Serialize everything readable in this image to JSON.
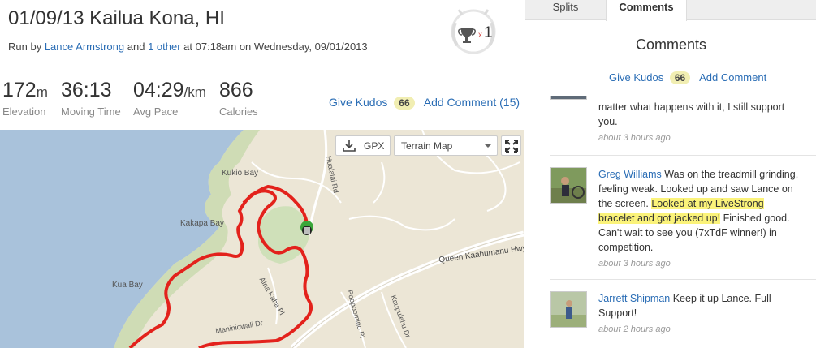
{
  "activity": {
    "title": "01/09/13 Kailua Kona, HI",
    "subtitle_prefix": "Run by",
    "athlete": "Lance Armstrong",
    "and": "and",
    "others": "1 other",
    "subtitle_suffix": "at 07:18am on Wednesday, 09/01/2013",
    "trophy_multiplier": "x",
    "trophy_count": "1"
  },
  "stats": [
    {
      "value": "172",
      "unit": "m",
      "label": "Elevation"
    },
    {
      "value": "36:13",
      "unit": "",
      "label": "Moving Time"
    },
    {
      "value": "04:29",
      "unit": "/km",
      "label": "Avg Pace"
    },
    {
      "value": "866",
      "unit": "",
      "label": "Calories"
    }
  ],
  "kudos": {
    "give_label": "Give Kudos",
    "count": "66",
    "add_comment_label": "Add Comment (15)"
  },
  "map": {
    "gpx_label": "GPX",
    "map_type": "Terrain Map",
    "labels": {
      "kukio_bay": "Kukio Bay",
      "kakapa_bay": "Kakapa Bay",
      "kua_bay": "Kua Bay",
      "highway": "Queen Kaahumanu Hwy",
      "aina_kaha": "Aina Kaha Pl",
      "poopoomino": "Poopoomino Pl",
      "kaupulehu": "Kaupulehu Dr",
      "maniniowali": "Maniniowali Dr",
      "hualalai": "Hualalai Rd"
    },
    "colors": {
      "route": "#e3221c",
      "water": "#a9c2db",
      "land": "#ece6d6",
      "park": "#cfe0b9"
    }
  },
  "sidebar": {
    "tabs": [
      "Splits",
      "Comments"
    ],
    "heading": "Comments",
    "give_kudos_label": "Give Kudos",
    "kudos_count": "66",
    "add_comment_label": "Add Comment"
  },
  "comments": [
    {
      "name": "",
      "text": "matter what happens with it, I still support you.",
      "highlight": "",
      "after": "",
      "time": "about 3 hours ago"
    },
    {
      "name": "Greg Williams",
      "text": "Was on the treadmill grinding, feeling weak. Looked up and saw Lance on the screen.",
      "highlight": "Looked at my LiveStrong bracelet and got jacked up!",
      "after": "Finished good. Can't wait to see you (7xTdF winner!) in competition.",
      "time": "about 3 hours ago"
    },
    {
      "name": "Jarrett Shipman",
      "text": "Keep it up Lance. Full Support!",
      "highlight": "",
      "after": "",
      "time": "about 2 hours ago"
    }
  ]
}
